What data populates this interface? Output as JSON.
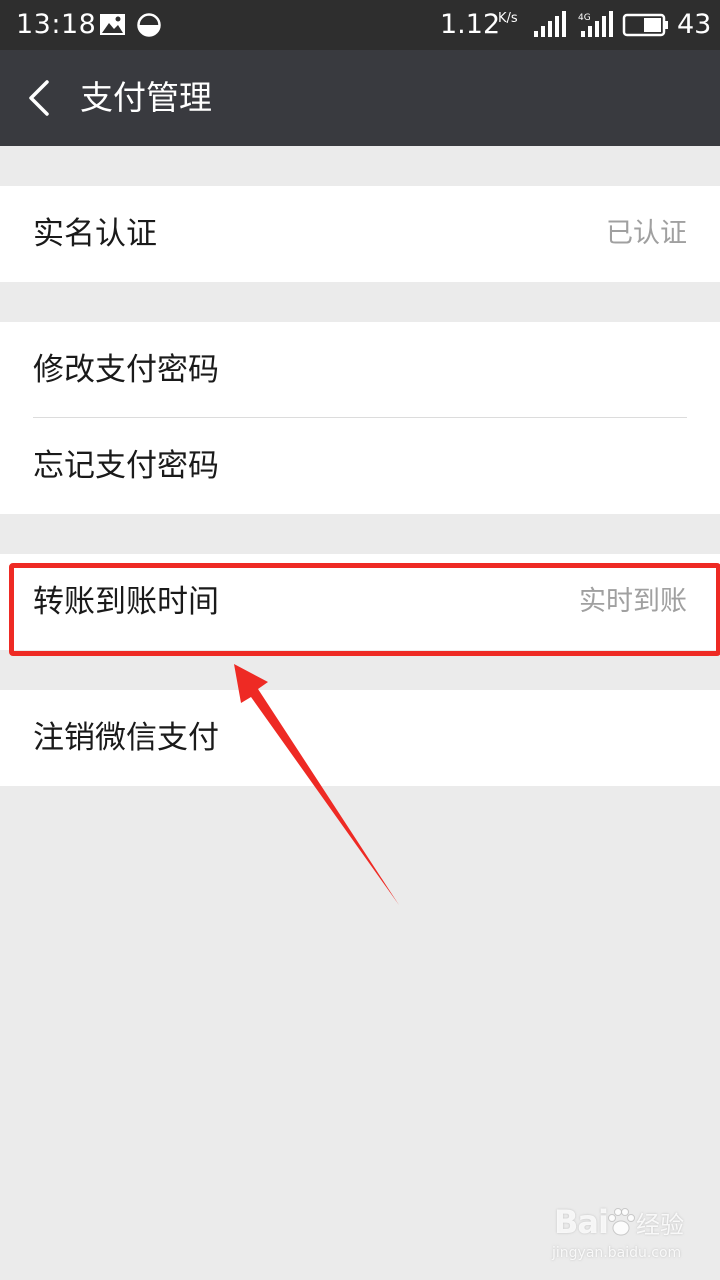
{
  "status_bar": {
    "time": "13:18",
    "speed": "1.12",
    "speed_unit": "K/s",
    "network_type": "4G",
    "battery_level": "43"
  },
  "header": {
    "title": "支付管理",
    "back_icon": "chevron-left-icon"
  },
  "groups": [
    {
      "items": [
        {
          "label": "实名认证",
          "value": "已认证"
        }
      ]
    },
    {
      "items": [
        {
          "label": "修改支付密码"
        },
        {
          "label": "忘记支付密码"
        }
      ]
    },
    {
      "items": [
        {
          "label": "转账到账时间",
          "value": "实时到账"
        }
      ]
    },
    {
      "items": [
        {
          "label": "注销微信支付"
        }
      ]
    }
  ],
  "annotation": {
    "highlight_color": "#ee2a24"
  },
  "watermark": {
    "brand": "Bai",
    "brand_suffix": "经验",
    "url": "jingyan.baidu.com"
  },
  "colors": {
    "status_bar_bg": "#2e2e2e",
    "title_bar_bg": "#393a3f",
    "page_bg": "#ebebeb",
    "cell_bg": "#ffffff",
    "secondary_text": "#a0a0a0"
  }
}
